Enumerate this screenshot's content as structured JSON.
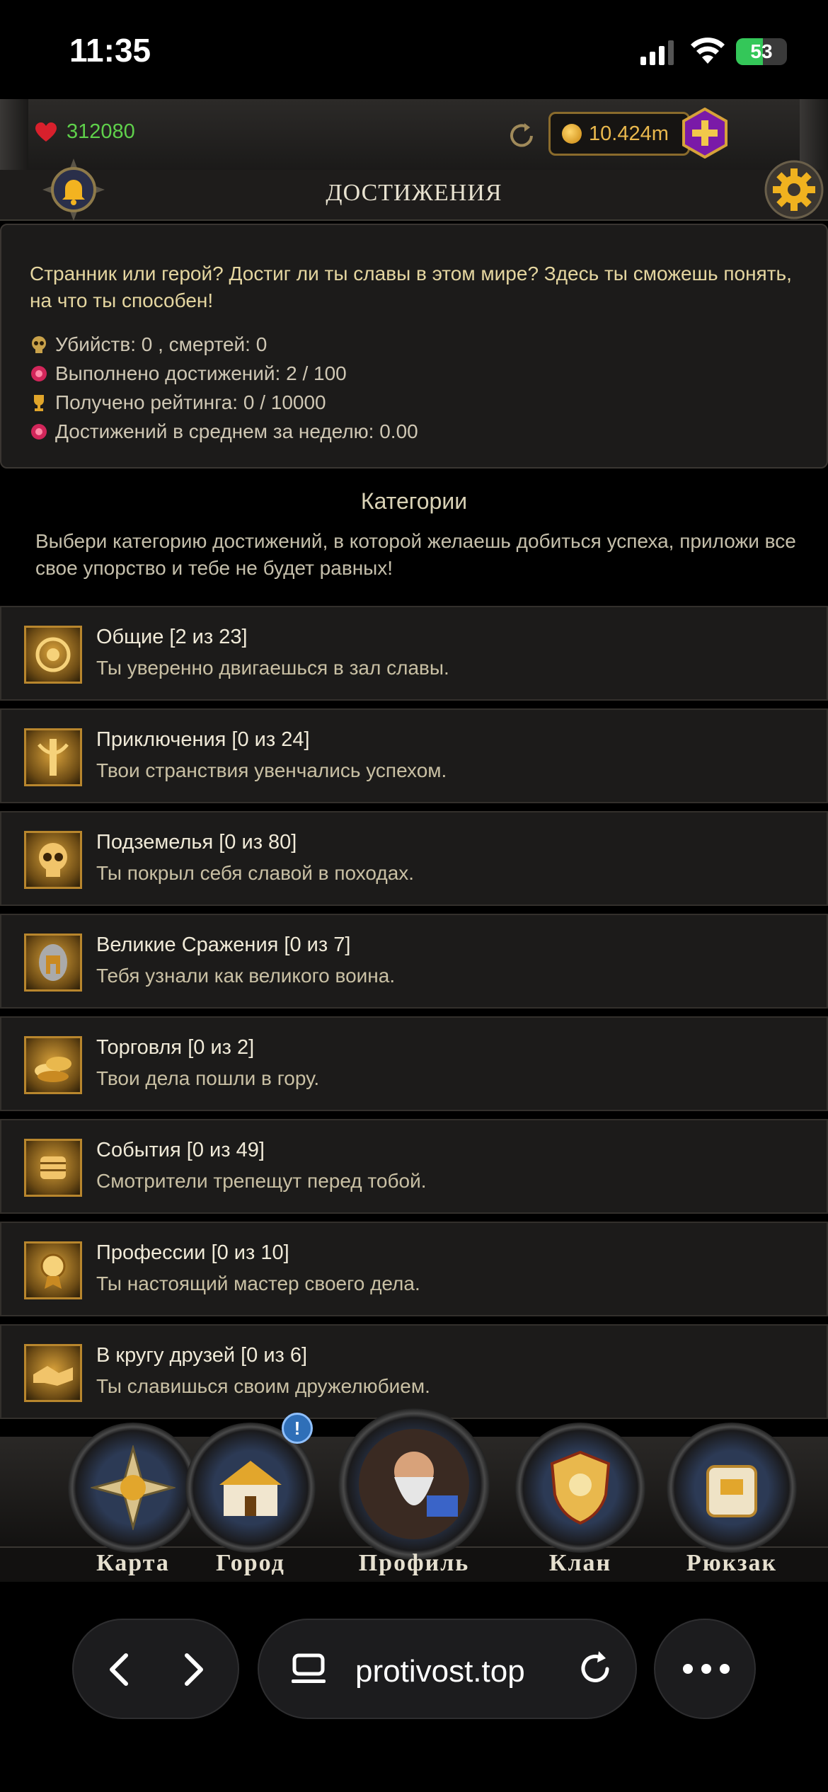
{
  "status_bar": {
    "time": "11:35",
    "battery": "53",
    "battery_level": 0.53
  },
  "header": {
    "hp": "312080",
    "gold": "10.424m",
    "title": "ДОСТИЖЕНИЯ"
  },
  "intro": {
    "text": "Странник или герой? Достиг ли ты славы в этом мире? Здесь ты сможешь понять, на что ты способен!",
    "stats": [
      {
        "icon": "skull-icon",
        "text": "Убийств: 0 , смертей: 0"
      },
      {
        "icon": "gem-icon",
        "text": "Выполнено достижений: 2 / 100"
      },
      {
        "icon": "trophy-icon",
        "text": "Получено рейтинга: 0 / 10000"
      },
      {
        "icon": "gem-icon",
        "text": "Достижений в среднем за неделю: 0.00"
      }
    ]
  },
  "categories": {
    "title": "Категории",
    "description": "Выбери категорию достижений, в которой желаешь добиться успеха, приложи все свое упорство и тебе не будет равных!",
    "items": [
      {
        "title": "Общие [2 из 23]",
        "subtitle": "Ты уверенно двигаешься в зал славы.",
        "icon": "general-icon"
      },
      {
        "title": "Приключения [0 из 24]",
        "subtitle": "Твои странствия увенчались успехом.",
        "icon": "adventure-icon"
      },
      {
        "title": "Подземелья [0 из 80]",
        "subtitle": "Ты покрыл себя славой в походах.",
        "icon": "dungeon-skull-icon"
      },
      {
        "title": "Великие Сражения [0 из 7]",
        "subtitle": "Тебя узнали как великого воина.",
        "icon": "helmet-icon"
      },
      {
        "title": "Торговля [0 из 2]",
        "subtitle": "Твои дела пошли в гору.",
        "icon": "gold-pile-icon"
      },
      {
        "title": "События [0 из 49]",
        "subtitle": "Смотрители трепещут перед тобой.",
        "icon": "fist-icon"
      },
      {
        "title": "Профессии [0 из 10]",
        "subtitle": "Ты настоящий мастер своего дела.",
        "icon": "medal-icon"
      },
      {
        "title": "В кругу друзей [0 из 6]",
        "subtitle": "Ты славишься своим дружелюбием.",
        "icon": "handshake-icon"
      }
    ]
  },
  "nav": {
    "items": [
      {
        "label": "Карта",
        "icon": "compass-icon"
      },
      {
        "label": "Город",
        "icon": "castle-icon"
      },
      {
        "label": "Профиль",
        "icon": "wizard-avatar-icon"
      },
      {
        "label": "Клан",
        "icon": "clan-shield-icon"
      },
      {
        "label": "Рюкзак",
        "icon": "backpack-icon"
      }
    ],
    "badge": "!"
  },
  "browser": {
    "url": "protivost.top"
  },
  "colors": {
    "accent_gold": "#e9b84d",
    "hp_green": "#5fd04b",
    "panel": "#1c1b1a"
  }
}
